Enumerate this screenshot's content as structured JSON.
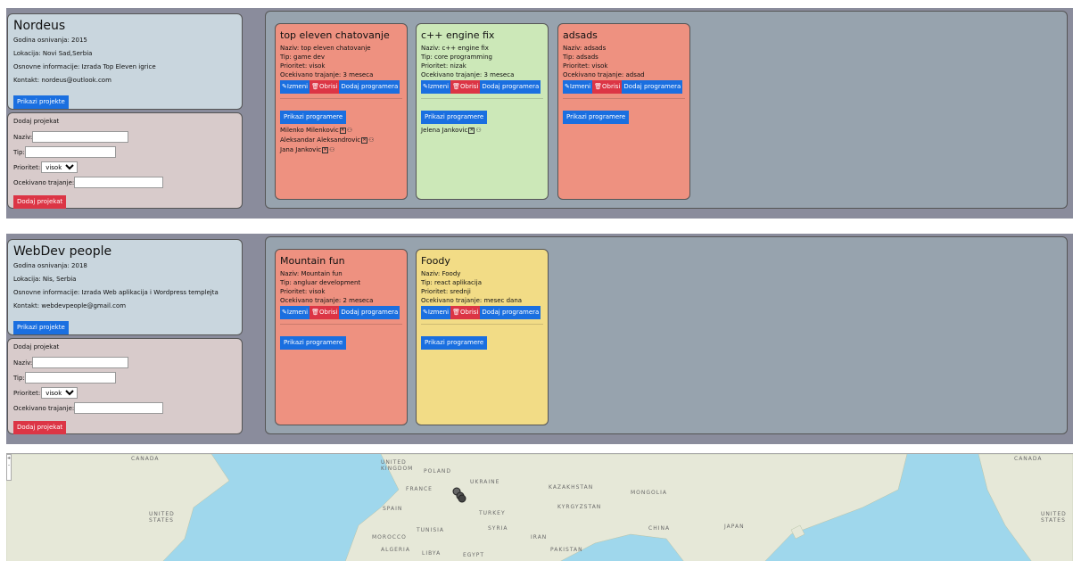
{
  "companies": [
    {
      "name": "Nordeus",
      "founded": "Godina osnivanja: 2015",
      "location": "Lokacija: Novi Sad,Serbia",
      "info": "Osnovne informacije: Izrada Top Eleven igrice",
      "contact": "Kontakt: nordeus@outlook.com",
      "show_projects": "Prikazi projekte",
      "form": {
        "title": "Dodaj projekat",
        "name_label": "Naziv:",
        "type_label": "Tip:",
        "priority_label": "Prioritet:",
        "priority_value": "visok",
        "duration_label": "Ocekivano trajanje:",
        "submit": "Dodaj projekat"
      },
      "projects": [
        {
          "title": "top eleven chatovanje",
          "naziv": "Naziv: top eleven chatovanje",
          "tip": "Tip: game dev",
          "prioritet": "Prioritet: visok",
          "trajanje": "Ocekivano trajanje: 3 meseca",
          "color": "#ee9180",
          "edit": "Izmeni",
          "delete": "Obrisi",
          "add_prog": "Dodaj programera",
          "show_prog": "Prikazi programere",
          "programmers": [
            "Milenko Milenkovic",
            "Aleksandar Aleksandrovic",
            "Jana Jankovic"
          ]
        },
        {
          "title": "c++ engine fix",
          "naziv": "Naziv: c++ engine fix",
          "tip": "Tip: core programming",
          "prioritet": "Prioritet: nizak",
          "trajanje": "Ocekivano trajanje: 3 meseca",
          "color": "#cce8b8",
          "edit": "Izmeni",
          "delete": "Obrisi",
          "add_prog": "Dodaj programera",
          "show_prog": "Prikazi programere",
          "programmers": [
            "Jelena Jankovic"
          ]
        },
        {
          "title": "adsads",
          "naziv": "Naziv: adsads",
          "tip": "Tip: adsads",
          "prioritet": "Prioritet: visok",
          "trajanje": "Ocekivano trajanje: adsad",
          "color": "#ee9180",
          "edit": "Izmeni",
          "delete": "Obrisi",
          "add_prog": "Dodaj programera",
          "show_prog": "Prikazi programere",
          "programmers": []
        }
      ]
    },
    {
      "name": "WebDev people",
      "founded": "Godina osnivanja: 2018",
      "location": "Lokacija: Nis, Serbia",
      "info": "Osnovne informacije: Izrada Web aplikacija i Wordpress templejta",
      "contact": "Kontakt: webdevpeople@gmail.com",
      "show_projects": "Prikazi projekte",
      "form": {
        "title": "Dodaj projekat",
        "name_label": "Naziv:",
        "type_label": "Tip:",
        "priority_label": "Prioritet:",
        "priority_value": "visok",
        "duration_label": "Ocekivano trajanje:",
        "submit": "Dodaj projekat"
      },
      "projects": [
        {
          "title": "Mountain fun",
          "naziv": "Naziv: Mountain fun",
          "tip": "Tip: angluar development",
          "prioritet": "Prioritet: visok",
          "trajanje": "Ocekivano trajanje: 2 meseca",
          "color": "#ee9180",
          "edit": "Izmeni",
          "delete": "Obrisi",
          "add_prog": "Dodaj programera",
          "show_prog": "Prikazi programere",
          "programmers": []
        },
        {
          "title": "Foody",
          "naziv": "Naziv: Foody",
          "tip": "Tip: react aplikacija",
          "prioritet": "Prioritet: srednji",
          "trajanje": "Ocekivano trajanje: mesec dana",
          "color": "#f2dc86",
          "edit": "Izmeni",
          "delete": "Obrisi",
          "add_prog": "Dodaj programera",
          "show_prog": "Prikazi programere",
          "programmers": []
        }
      ]
    }
  ],
  "map": {
    "zoom_in": "+",
    "zoom_out": "-",
    "labels": [
      "CANADA",
      "UNITED KINGDOM",
      "POLAND",
      "UKRAINE",
      "FRANCE",
      "KAZAKHSTAN",
      "MONGOLIA",
      "SPAIN",
      "TURKEY",
      "KYRGYZSTAN",
      "UNITED STATES",
      "CHINA",
      "JAPAN",
      "TUNISIA",
      "SYRIA",
      "IRAN",
      "MOROCCO",
      "ALGERIA",
      "LIBYA",
      "EGYPT",
      "PAKISTAN",
      "CANADA",
      "UNITED STATES"
    ],
    "land_color": "#e6e8d8",
    "water_color": "#9fd7ec"
  }
}
